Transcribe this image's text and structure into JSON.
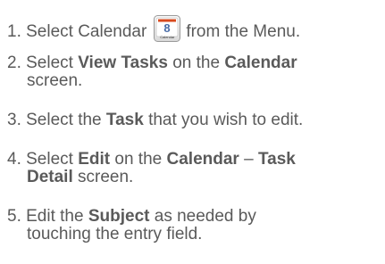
{
  "steps": [
    {
      "prefix": "1. Select Calendar",
      "suffix": "from the Menu.",
      "icon": {
        "name": "calendar-icon",
        "number": "8",
        "label": "Calendar",
        "accent": "#d94a1e"
      }
    },
    {
      "line1_a": "2. Select ",
      "line1_b1": "View Tasks",
      "line1_c": " on the ",
      "line1_b2": "Calendar",
      "line2": "screen."
    },
    {
      "a": "3. Select the ",
      "b": "Task",
      "c": " that you wish to edit."
    },
    {
      "line1_a": "4. Select ",
      "line1_b1": "Edit",
      "line1_c": " on the ",
      "line1_b2": "Calendar",
      "line1_d": " – ",
      "line1_b3": "Task",
      "line2_b": "Detail",
      "line2_c": " screen."
    },
    {
      "line1_a": "5. Edit the ",
      "line1_b": "Subject",
      "line1_c": " as needed by",
      "line2": "touching the entry field."
    }
  ],
  "colors": {
    "text": "#5a5a5a"
  }
}
